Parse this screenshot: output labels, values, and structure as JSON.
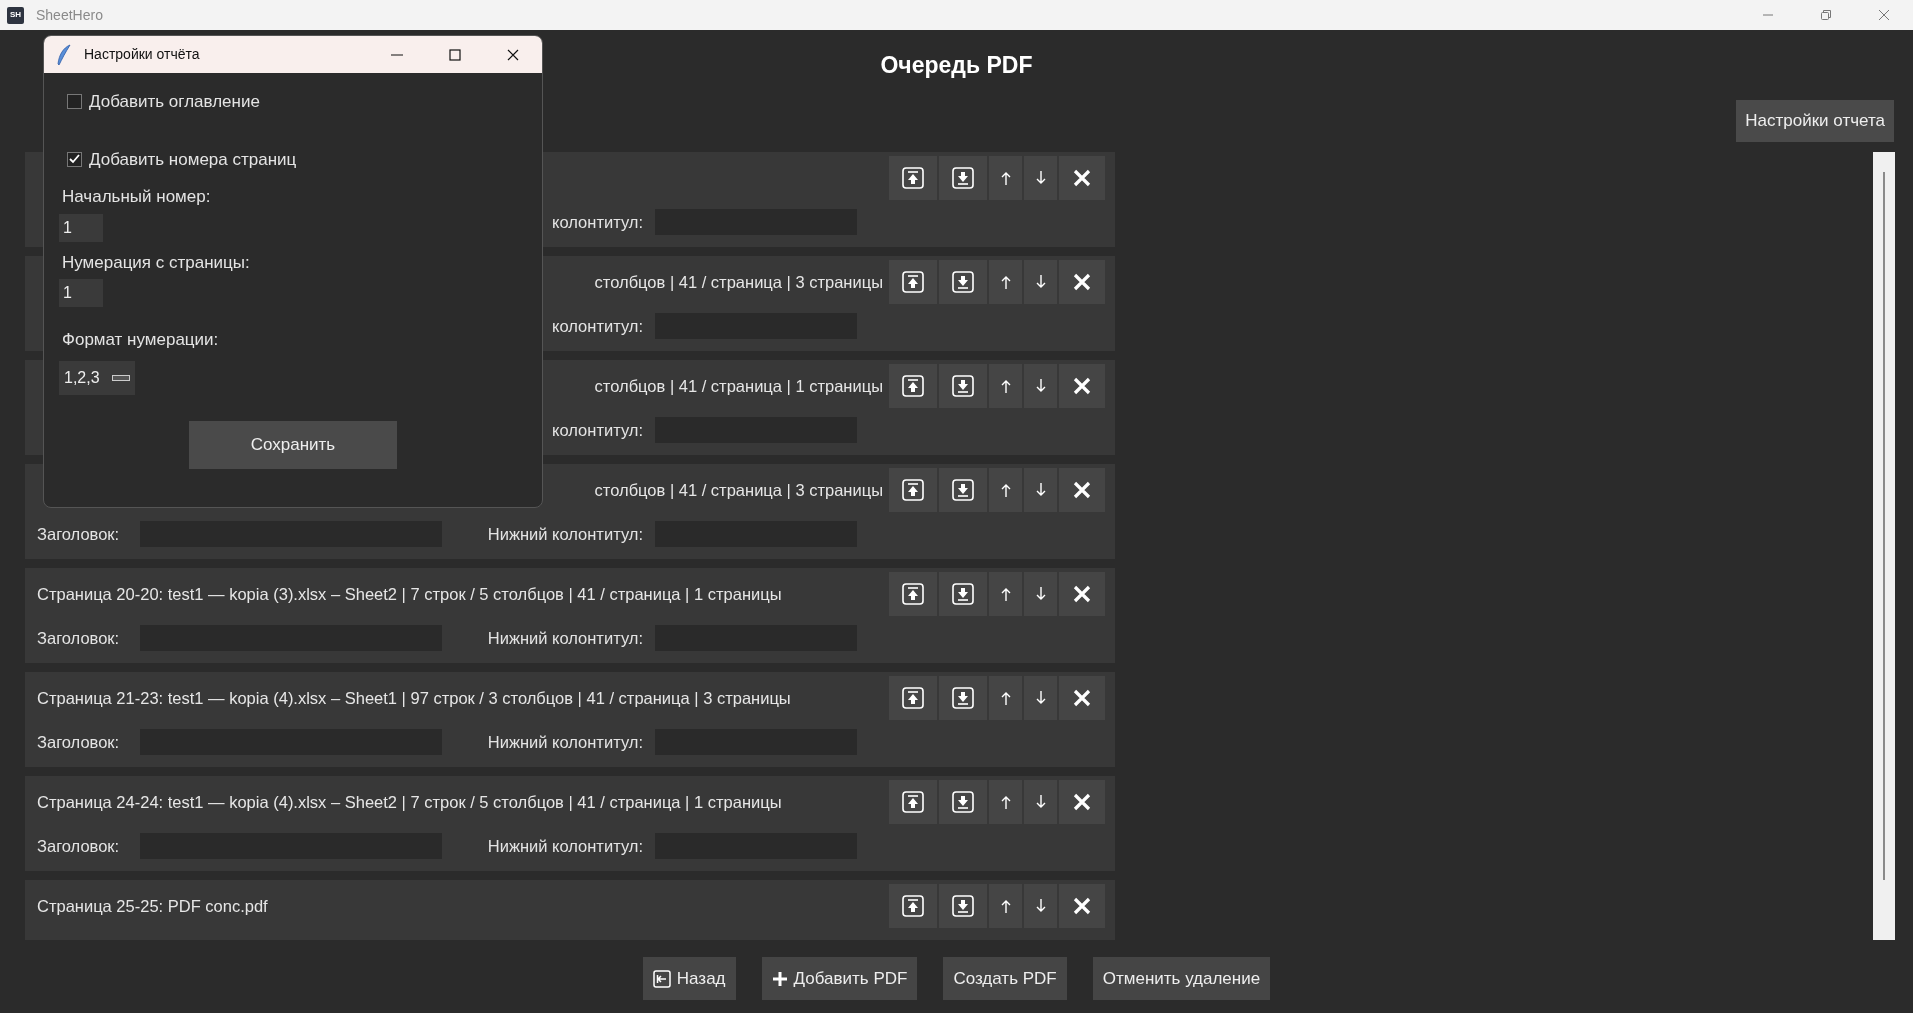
{
  "app": {
    "logo": "SH",
    "title": "SheetHero"
  },
  "heading": "Очередь PDF",
  "settings_button": "Настройки отчета",
  "rows": [
    {
      "kind": "covered",
      "footer_label": "колонтитул:"
    },
    {
      "kind": "covered",
      "description": "столбцов | 41 / страница | 3 страницы",
      "footer_label": "колонтитул:"
    },
    {
      "kind": "covered",
      "description": "столбцов | 41 / страница | 1 страницы",
      "footer_label": "колонтитул:"
    },
    {
      "kind": "covered",
      "description": "столбцов | 41 / страница | 3 страницы",
      "header_label": "Заголовок:",
      "footer_label": "Нижний колонтитул:"
    },
    {
      "kind": "full",
      "description": "Страница 20-20: test1 — kopia (3).xlsx – Sheet2 | 7 строк / 5 столбцов | 41 / страница | 1 страницы",
      "header_label": "Заголовок:",
      "footer_label": "Нижний колонтитул:"
    },
    {
      "kind": "full",
      "description": "Страница 21-23: test1 — kopia (4).xlsx – Sheet1 | 97 строк / 3 столбцов | 41 / страница | 3 страницы",
      "header_label": "Заголовок:",
      "footer_label": "Нижний колонтитул:"
    },
    {
      "kind": "full",
      "description": "Страница 24-24: test1 — kopia (4).xlsx – Sheet2 | 7 строк / 5 столбцов | 41 / страница | 1 страницы",
      "header_label": "Заголовок:",
      "footer_label": "Нижний колонтитул:"
    },
    {
      "kind": "full",
      "description": "Страница 25-25: PDF conc.pdf"
    }
  ],
  "footer_buttons": [
    {
      "label": "Назад",
      "kind": "back"
    },
    {
      "label": "Добавить PDF",
      "kind": "add"
    },
    {
      "label": "Создать PDF",
      "kind": "plain"
    },
    {
      "label": "Отменить удаление",
      "kind": "plain"
    }
  ],
  "dialog": {
    "title": "Настройки отчёта",
    "checkboxes": [
      {
        "label": "Добавить оглавление",
        "checked": false
      },
      {
        "label": "Добавить номера страниц",
        "checked": true
      }
    ],
    "fields": [
      {
        "label": "Начальный номер:",
        "value": "1"
      },
      {
        "label": "Нумерация с страницы:",
        "value": "1"
      }
    ],
    "format": {
      "label": "Формат нумерации:",
      "value": "1,2,3"
    },
    "save_button": "Сохранить"
  }
}
